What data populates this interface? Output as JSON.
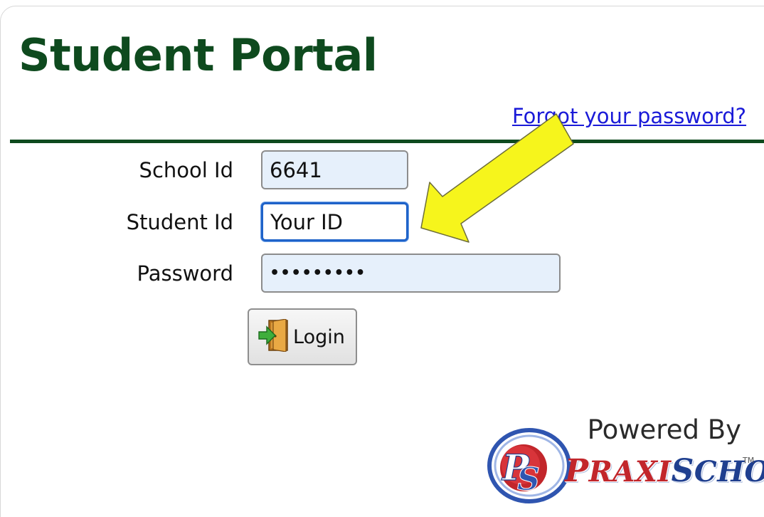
{
  "portal": {
    "title": "Student Portal",
    "forgot_password": "Forgot your password?"
  },
  "form": {
    "school_id": {
      "label": "School Id",
      "value": "6641"
    },
    "student_id": {
      "label": "Student Id",
      "value": "Your ID"
    },
    "password": {
      "label": "Password",
      "value": "•••••••••"
    },
    "login_label": "Login"
  },
  "footer": {
    "powered_by": "Powered By",
    "brand_prefix_big": "P",
    "brand_prefix_rest": "RAXI",
    "brand_suffix_big": "S",
    "brand_suffix_rest": "CHOOL",
    "brand_tm": "TM",
    "brand_monogram": "PS"
  },
  "icons": {
    "login": "door-enter-icon",
    "annotation": "yellow-arrow-icon",
    "logo": "praxischool-logo-icon"
  },
  "colors": {
    "title_green": "#0e4a1e",
    "link_blue": "#1a1ad8",
    "focus_blue": "#1f63c9",
    "input_fill": "#e6f0fb",
    "arrow_yellow": "#f6f51c",
    "brand_red": "#c2262b",
    "brand_blue": "#1f3f8f"
  }
}
